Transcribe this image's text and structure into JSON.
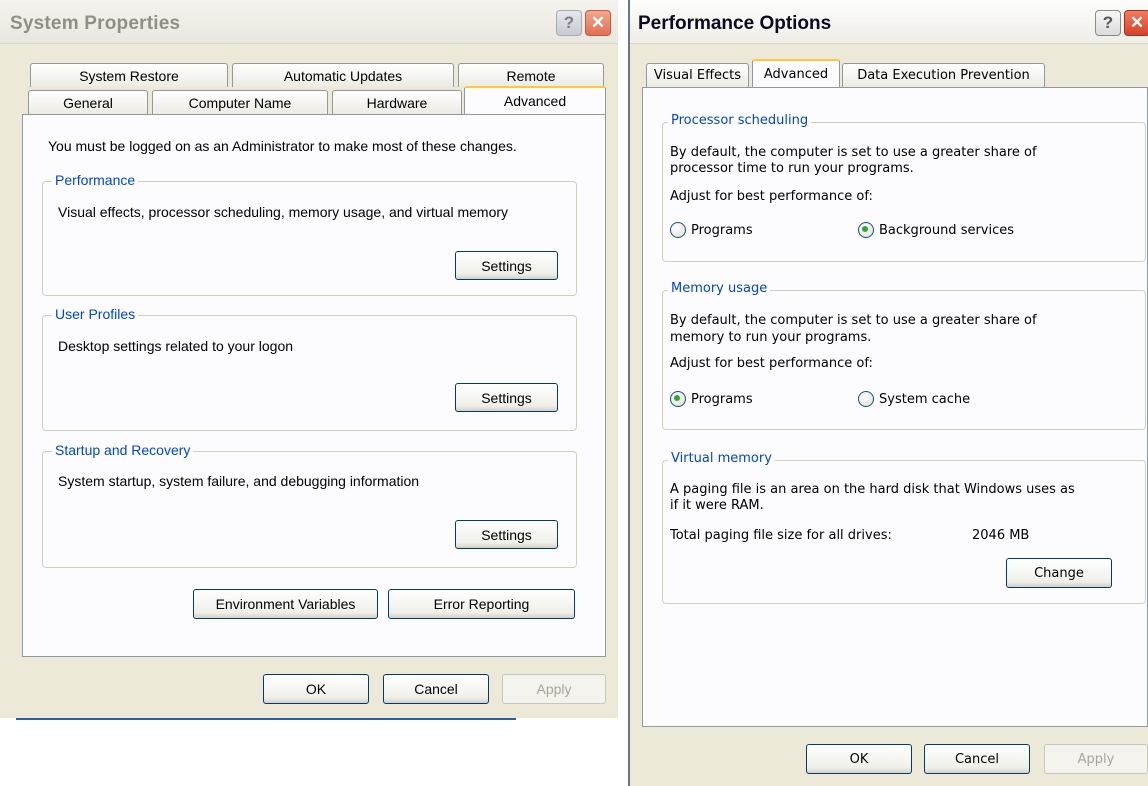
{
  "system_properties": {
    "title": "System Properties",
    "help_symbol": "?",
    "close_symbol": "✕",
    "tabs_row1": [
      "System Restore",
      "Automatic Updates",
      "Remote"
    ],
    "tabs_row2": [
      "General",
      "Computer Name",
      "Hardware",
      "Advanced"
    ],
    "active_tab": "Advanced",
    "admin_note": "You must be logged on as an Administrator to make most of these changes.",
    "groups": [
      {
        "title": "Performance",
        "description": "Visual effects, processor scheduling, memory usage, and virtual memory",
        "button": "Settings"
      },
      {
        "title": "User Profiles",
        "description": "Desktop settings related to your logon",
        "button": "Settings"
      },
      {
        "title": "Startup and Recovery",
        "description": "System startup, system failure, and debugging information",
        "button": "Settings"
      }
    ],
    "environment_variables_button": "Environment Variables",
    "error_reporting_button": "Error Reporting",
    "ok_button": "OK",
    "cancel_button": "Cancel",
    "apply_button": "Apply"
  },
  "performance_options": {
    "title": "Performance Options",
    "help_symbol": "?",
    "close_symbol": "✕",
    "tabs": [
      "Visual Effects",
      "Advanced",
      "Data Execution Prevention"
    ],
    "active_tab": "Advanced",
    "processor_scheduling": {
      "title": "Processor scheduling",
      "description_line1": "By default, the computer is set to use a greater share of",
      "description_line2": "processor time to run your programs.",
      "adjust_label": "Adjust for best performance of:",
      "option_programs": "Programs",
      "option_background": "Background services",
      "selected": "Background services"
    },
    "memory_usage": {
      "title": "Memory usage",
      "description_line1": "By default, the computer is set to use a greater share of",
      "description_line2": "memory to run your programs.",
      "adjust_label": "Adjust for best performance of:",
      "option_programs": "Programs",
      "option_cache": "System cache",
      "selected": "Programs"
    },
    "virtual_memory": {
      "title": "Virtual memory",
      "description_line1": "A paging file is an area on the hard disk that Windows uses as",
      "description_line2": "if it were RAM.",
      "paging_label": "Total paging file size for all drives:",
      "paging_value": "2046 MB",
      "change_button": "Change"
    },
    "ok_button": "OK",
    "cancel_button": "Cancel",
    "apply_button": "Apply"
  }
}
